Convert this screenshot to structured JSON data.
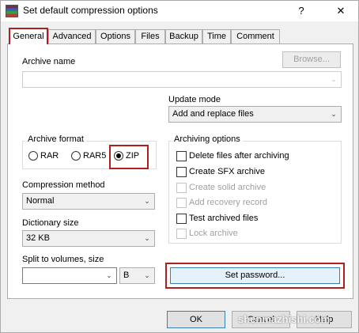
{
  "window": {
    "title": "Set default compression options",
    "help_label": "?",
    "close_label": "✕",
    "app_icon": "winrar-books-icon"
  },
  "tabs": [
    {
      "label": "General",
      "active": true
    },
    {
      "label": "Advanced"
    },
    {
      "label": "Options"
    },
    {
      "label": "Files"
    },
    {
      "label": "Backup"
    },
    {
      "label": "Time"
    },
    {
      "label": "Comment"
    }
  ],
  "archive_name": {
    "label": "Archive name",
    "value": "",
    "browse_label": "Browse..."
  },
  "update_mode": {
    "label": "Update mode",
    "value": "Add and replace files"
  },
  "archive_format": {
    "label": "Archive format",
    "options": [
      "RAR",
      "RAR5",
      "ZIP"
    ],
    "selected": "ZIP"
  },
  "compression_method": {
    "label": "Compression method",
    "value": "Normal"
  },
  "dictionary_size": {
    "label": "Dictionary size",
    "value": "32 KB"
  },
  "split_volumes": {
    "label": "Split to volumes, size",
    "value": "",
    "unit": "B"
  },
  "archiving_options": {
    "label": "Archiving options",
    "items": [
      {
        "label": "Delete files after archiving",
        "checked": false,
        "enabled": true
      },
      {
        "label": "Create SFX archive",
        "checked": false,
        "enabled": true
      },
      {
        "label": "Create solid archive",
        "checked": false,
        "enabled": false
      },
      {
        "label": "Add recovery record",
        "checked": false,
        "enabled": false
      },
      {
        "label": "Test archived files",
        "checked": false,
        "enabled": true
      },
      {
        "label": "Lock archive",
        "checked": false,
        "enabled": false
      }
    ]
  },
  "set_password_label": "Set password...",
  "footer": {
    "ok_label": "OK",
    "cancel_label": "Cancel",
    "help_label": "Help"
  },
  "watermark": "shenmazhishi.com",
  "colors": {
    "highlight": "#b01e1e",
    "dialog_bg": "#f0f0f0",
    "panel_bg": "#ffffff",
    "default_button_border": "#3c7fb1"
  }
}
